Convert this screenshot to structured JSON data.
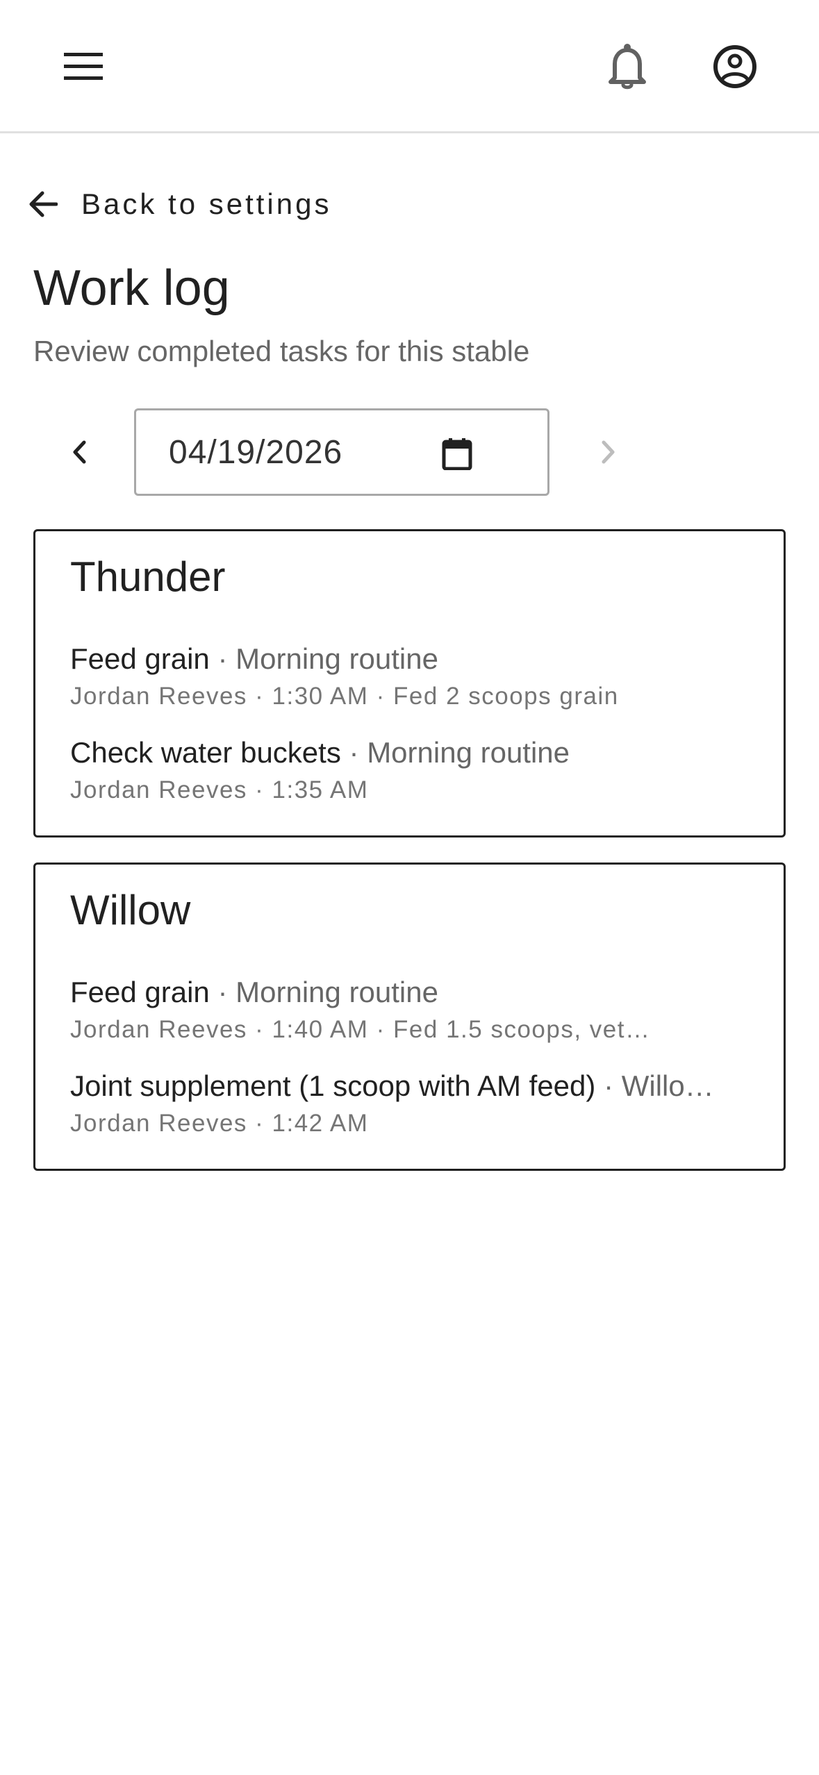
{
  "header": {
    "menu_icon": "hamburger-menu-icon",
    "notifications_icon": "bell-icon",
    "account_icon": "account-circle-icon"
  },
  "back": {
    "label": "Back to settings",
    "icon": "arrow-left-icon"
  },
  "page": {
    "title": "Work log",
    "subtitle": "Review completed tasks for this stable"
  },
  "date_picker": {
    "value": "04/19/2026",
    "prev_icon": "chevron-left-icon",
    "next_icon": "chevron-right-icon",
    "calendar_icon": "calendar-icon",
    "next_disabled": true
  },
  "separator": "·",
  "horses": [
    {
      "name": "Thunder",
      "tasks": [
        {
          "task": "Feed grain",
          "routine": "Morning routine",
          "meta": "Jordan Reeves · 1:30 AM · Fed 2 scoops grain"
        },
        {
          "task": "Check water buckets",
          "routine": "Morning routine",
          "meta": "Jordan Reeves · 1:35 AM"
        }
      ]
    },
    {
      "name": "Willow",
      "tasks": [
        {
          "task": "Feed grain",
          "routine": "Morning routine",
          "meta": "Jordan Reeves · 1:40 AM · Fed 1.5 scoops, vet…"
        },
        {
          "task": "Joint supplement (1 scoop with AM feed)",
          "routine": "Willo…",
          "meta": "Jordan Reeves · 1:42 AM"
        }
      ]
    }
  ]
}
